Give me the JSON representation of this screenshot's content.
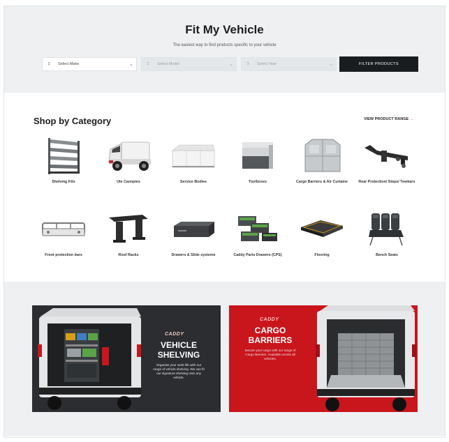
{
  "fit": {
    "title": "Fit My Vehicle",
    "subtitle": "The easiest way to find products specific to your vehicle",
    "make": {
      "num": "1",
      "placeholder": "Select Make"
    },
    "model": {
      "num": "2",
      "placeholder": "Select Model"
    },
    "year": {
      "num": "3",
      "placeholder": "Select Year"
    },
    "filter_label": "FILTER PRODUCTS"
  },
  "categories_section": {
    "title": "Shop by Category",
    "view_label": "VIEW PRODUCT RANGE",
    "view_arrow": "→",
    "items": [
      {
        "label": "Shelving Kits",
        "icon": "shelving-icon"
      },
      {
        "label": "Ute Canopies",
        "icon": "ute-icon"
      },
      {
        "label": "Service Bodies",
        "icon": "service-body-icon"
      },
      {
        "label": "Toolboxes",
        "icon": "toolbox-icon"
      },
      {
        "label": "Cargo Barriers & Air Curtains",
        "icon": "cargo-barrier-icon"
      },
      {
        "label": "Rear Protection/ Steps/ Towbars",
        "icon": "towbar-icon"
      },
      {
        "label": "Front protection bars",
        "icon": "bullbar-icon"
      },
      {
        "label": "Roof Racks",
        "icon": "roof-rack-icon"
      },
      {
        "label": "Drawers & Slide systems",
        "icon": "drawer-icon"
      },
      {
        "label": "Caddy Parts Drawers (CPS)",
        "icon": "parts-drawer-icon"
      },
      {
        "label": "Flooring",
        "icon": "flooring-icon"
      },
      {
        "label": "Bench Seats",
        "icon": "bench-seat-icon"
      }
    ]
  },
  "banners": {
    "shelving": {
      "brand": "CADDY",
      "heading1": "VEHICLE",
      "heading2": "SHELVING",
      "text1": "Organise your work life with our",
      "text2": "range of vehicle shelving. We can fit",
      "text3": "our signature shelving onto any",
      "text4": "vehicle."
    },
    "barriers": {
      "brand": "CADDY",
      "heading1": "CARGO",
      "heading2": "BARRIERS",
      "text1": "Secure your cargo with our range of",
      "text2": "Cargo Barriers. Available across all",
      "text3": "vehicles."
    }
  },
  "colors": {
    "accent": "#e0262b",
    "button_dark": "#1a1d20",
    "banner_red": "#c9151c",
    "banner_dark": "#2b2d30"
  }
}
